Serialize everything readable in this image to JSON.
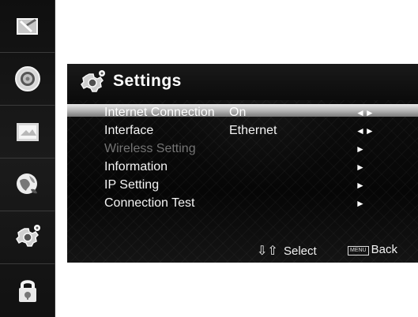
{
  "sidebar": {
    "items": [
      {
        "icon": "monitor-icon"
      },
      {
        "icon": "speaker-icon"
      },
      {
        "icon": "picture-icon"
      },
      {
        "icon": "globe-icon"
      },
      {
        "icon": "settings-gear-icon"
      },
      {
        "icon": "lock-icon"
      }
    ]
  },
  "panel": {
    "title": "Settings",
    "rows": [
      {
        "label": "Internet Connection",
        "value": "On",
        "arrow": "◄►"
      },
      {
        "label": "Interface",
        "value": "Ethernet",
        "arrow": "◄►"
      },
      {
        "label": "Wireless Setting",
        "value": "",
        "arrow": "►"
      },
      {
        "label": "Information",
        "value": "",
        "arrow": "►"
      },
      {
        "label": "IP Setting",
        "value": "",
        "arrow": "►"
      },
      {
        "label": "Connection Test",
        "value": "",
        "arrow": "►"
      }
    ],
    "footer": {
      "select_glyph": "⇩⇧",
      "select": "Select",
      "menu_key": "MENU",
      "back": "Back"
    }
  },
  "colors": {
    "panel_background": "#080808",
    "disabled_text": "#747474",
    "highlight_bar": "#bdbdbd"
  }
}
